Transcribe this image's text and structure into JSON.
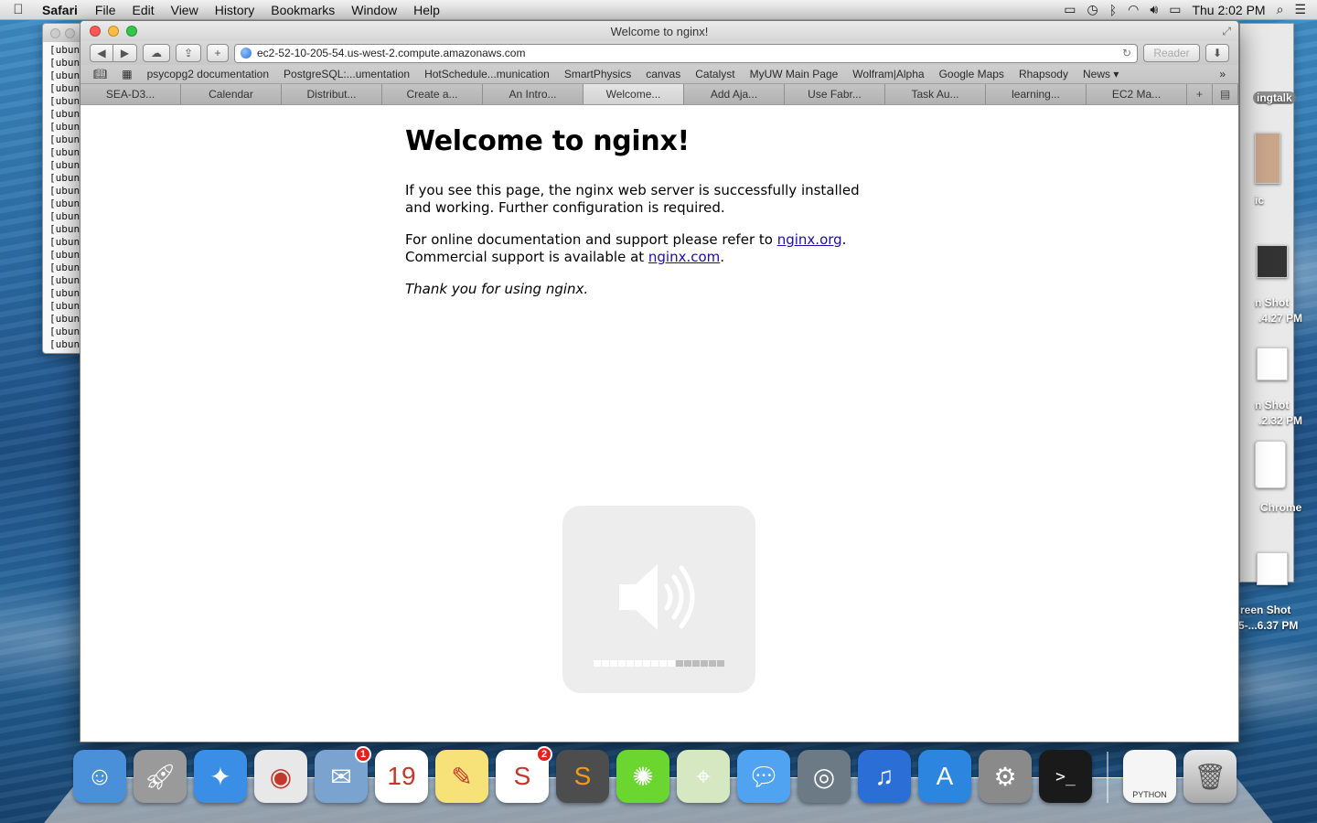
{
  "menubar": {
    "app_name": "Safari",
    "items": [
      "File",
      "Edit",
      "View",
      "History",
      "Bookmarks",
      "Window",
      "Help"
    ],
    "clock": "Thu 2:02 PM"
  },
  "terminal": {
    "line_text": "[ubunt"
  },
  "desktop": {
    "labels": [
      "ingtalk",
      "ic",
      "n Shot",
      ".4.27 PM",
      "n Shot",
      ".2.32 PM",
      "Chrome",
      "reen Shot",
      "5-...6.37 PM"
    ]
  },
  "safari": {
    "window_title": "Welcome to nginx!",
    "url": "ec2-52-10-205-54.us-west-2.compute.amazonaws.com",
    "reader_label": "Reader",
    "bookmarks": [
      "psycopg2 documentation",
      "PostgreSQL:...umentation",
      "HotSchedule...munication",
      "SmartPhysics",
      "canvas",
      "Catalyst",
      "MyUW Main Page",
      "Wolfram|Alpha",
      "Google Maps",
      "Rhapsody",
      "News ▾"
    ],
    "tabs": [
      "SEA-D3...",
      "Calendar",
      "Distribut...",
      "Create a...",
      "An Intro...",
      "Welcome...",
      "Add Aja...",
      "Use Fabr...",
      "Task Au...",
      "learning...",
      "EC2 Ma..."
    ],
    "active_tab_index": 5
  },
  "page": {
    "heading": "Welcome to nginx!",
    "p1": "If you see this page, the nginx web server is successfully installed and working. Further configuration is required.",
    "p2_prefix": "For online documentation and support please refer to ",
    "link1": "nginx.org",
    "p2_mid": ". Commercial support is available at ",
    "link2": "nginx.com",
    "p2_suffix": ".",
    "thanks": "Thank you for using nginx."
  },
  "volume_hud": {
    "level_fraction": 0.625,
    "total_segments": 16
  },
  "dock": {
    "apps": [
      {
        "name": "Finder",
        "icon": "finder-icon",
        "color": "#4a90d9"
      },
      {
        "name": "Launchpad",
        "icon": "rocket-icon",
        "color": "#9a9a9a"
      },
      {
        "name": "Safari",
        "icon": "compass-icon",
        "color": "#3a8ee6"
      },
      {
        "name": "Chrome",
        "icon": "chrome-icon",
        "color": "#e8e8e8"
      },
      {
        "name": "Mail",
        "icon": "mail-icon",
        "color": "#7aa4cf",
        "badge": "1"
      },
      {
        "name": "Calendar",
        "icon": "calendar-icon",
        "color": "#ffffff"
      },
      {
        "name": "Stickies",
        "icon": "notes-icon",
        "color": "#f7e27a"
      },
      {
        "name": "Slack",
        "icon": "slack-icon",
        "color": "#ffffff",
        "badge": "2"
      },
      {
        "name": "Sublime Text",
        "icon": "sublime-icon",
        "color": "#4d4d4d"
      },
      {
        "name": "LimeChat",
        "icon": "lime-icon",
        "color": "#6bd62f"
      },
      {
        "name": "Maps",
        "icon": "maps-icon",
        "color": "#d6e8c2"
      },
      {
        "name": "Messages",
        "icon": "messages-icon",
        "color": "#4fa3f0"
      },
      {
        "name": "FaceTime",
        "icon": "camera-icon",
        "color": "#6c7a86"
      },
      {
        "name": "iTunes",
        "icon": "music-icon",
        "color": "#2b6fd6"
      },
      {
        "name": "App Store",
        "icon": "appstore-icon",
        "color": "#2c86e0"
      },
      {
        "name": "System Preferences",
        "icon": "gear-icon",
        "color": "#8a8a8a"
      },
      {
        "name": "Terminal",
        "icon": "terminal-icon",
        "color": "#1a1a1a"
      }
    ],
    "folder_label": "PYTHON"
  }
}
